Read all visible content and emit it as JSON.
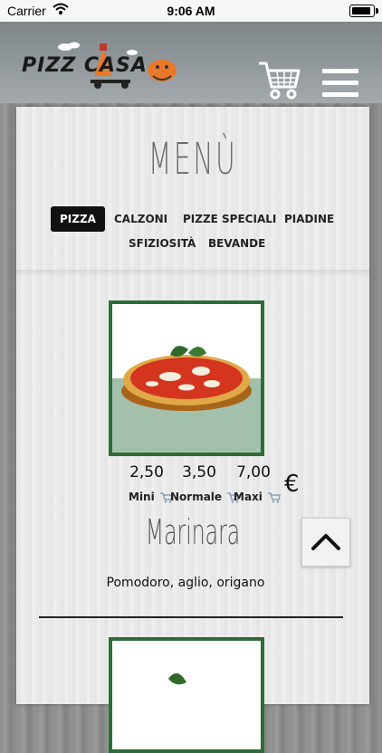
{
  "status_bar": {
    "carrier": "Carrier",
    "time": "9:06 AM"
  },
  "header": {
    "logo_text": "PIZZ CASA",
    "icons": [
      "cart-icon",
      "hamburger-menu-icon"
    ]
  },
  "menu": {
    "title": "MENÙ",
    "tabs": [
      {
        "label": "PIZZA",
        "active": true
      },
      {
        "label": "CALZONI",
        "active": false
      },
      {
        "label": "PIZZE SPECIALI",
        "active": false
      },
      {
        "label": "PIADINE",
        "active": false
      },
      {
        "label": "SFIZIOSITÀ",
        "active": false
      },
      {
        "label": "BEVANDE",
        "active": false
      }
    ]
  },
  "product": {
    "prices": [
      "2,50",
      "3,50",
      "7,00"
    ],
    "currency": "€",
    "sizes": [
      "Mini",
      "Normale",
      "Maxi"
    ],
    "name": "Marinara",
    "description": "Pomodoro, aglio, origano"
  },
  "colors": {
    "accent_green": "#2f6b3b",
    "active_tab": "#111111"
  }
}
